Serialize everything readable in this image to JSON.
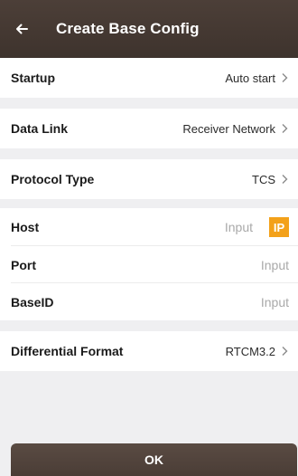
{
  "header": {
    "title": "Create Base Config",
    "back_icon": "arrow-left-icon"
  },
  "rows": {
    "startup": {
      "label": "Startup",
      "value": "Auto start"
    },
    "data_link": {
      "label": "Data Link",
      "value": "Receiver Network"
    },
    "protocol_type": {
      "label": "Protocol Type",
      "value": "TCS"
    },
    "host": {
      "label": "Host",
      "placeholder": "Input",
      "badge": "IP"
    },
    "port": {
      "label": "Port",
      "placeholder": "Input"
    },
    "base_id": {
      "label": "BaseID",
      "placeholder": "Input"
    },
    "differential_format": {
      "label": "Differential Format",
      "value": "RTCM3.2"
    }
  },
  "footer": {
    "ok_label": "OK"
  },
  "colors": {
    "header": "#3e332d",
    "accent": "#f3a11a",
    "background": "#efeff1"
  }
}
